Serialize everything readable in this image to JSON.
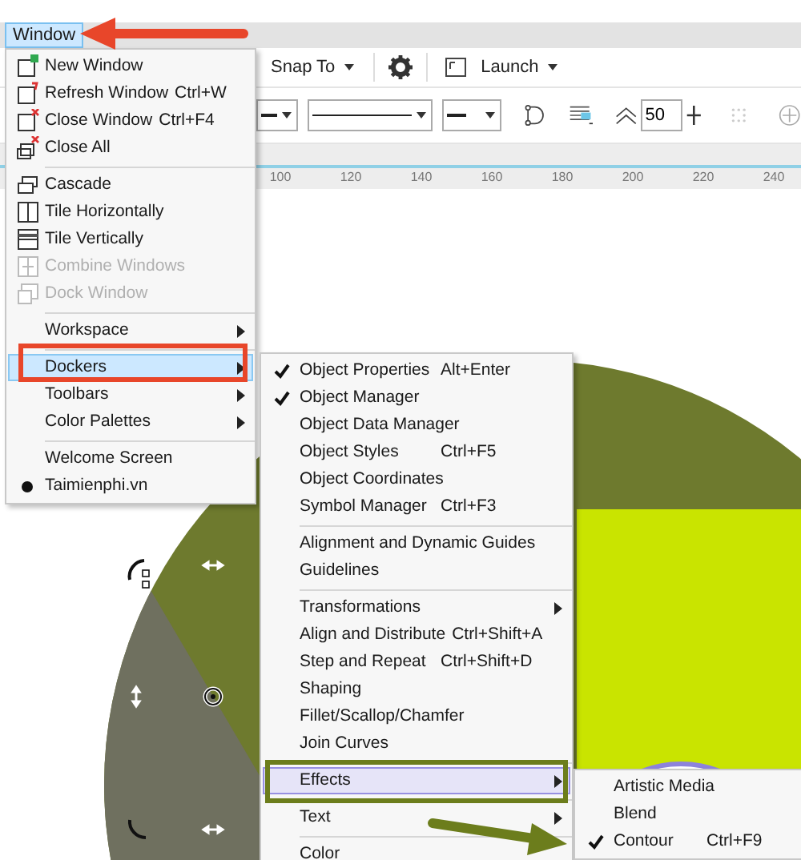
{
  "menu_bar": {
    "items": [
      {
        "label": "Window",
        "selected": true
      }
    ]
  },
  "toolbar": {
    "snap_button": {
      "label": "Snap To"
    },
    "launch_button": {
      "label": "Launch"
    }
  },
  "property_bar": {
    "smoothing_value": "50"
  },
  "ruler": {
    "labels": [
      "100",
      "120",
      "140",
      "160",
      "180",
      "200",
      "220",
      "240"
    ]
  },
  "window_menu": {
    "items": [
      {
        "kind": "item",
        "label": "New Window",
        "disabled": false,
        "selected": false,
        "checked": false,
        "submenu": false
      },
      {
        "kind": "item",
        "label": "Refresh Window",
        "shortcut": "Ctrl+W",
        "disabled": false,
        "selected": false,
        "checked": false,
        "submenu": false
      },
      {
        "kind": "item",
        "label": "Close Window",
        "shortcut": "Ctrl+F4",
        "disabled": false,
        "selected": false,
        "checked": false,
        "submenu": false
      },
      {
        "kind": "item",
        "label": "Close All",
        "disabled": false,
        "selected": false,
        "checked": false,
        "submenu": false
      },
      {
        "kind": "separator"
      },
      {
        "kind": "item",
        "label": "Cascade",
        "disabled": false,
        "selected": false,
        "checked": false,
        "submenu": false
      },
      {
        "kind": "item",
        "label": "Tile Horizontally",
        "disabled": false,
        "selected": false,
        "checked": false,
        "submenu": false
      },
      {
        "kind": "item",
        "label": "Tile Vertically",
        "disabled": false,
        "selected": false,
        "checked": false,
        "submenu": false
      },
      {
        "kind": "item",
        "label": "Combine Windows",
        "disabled": true,
        "selected": false,
        "checked": false,
        "submenu": false
      },
      {
        "kind": "item",
        "label": "Dock Window",
        "disabled": true,
        "selected": false,
        "checked": false,
        "submenu": false
      },
      {
        "kind": "separator"
      },
      {
        "kind": "item",
        "label": "Workspace",
        "disabled": false,
        "selected": false,
        "checked": false,
        "submenu": true
      },
      {
        "kind": "separator"
      },
      {
        "kind": "item",
        "label": "Dockers",
        "disabled": false,
        "selected": true,
        "checked": false,
        "submenu": true
      },
      {
        "kind": "item",
        "label": "Toolbars",
        "disabled": false,
        "selected": false,
        "checked": false,
        "submenu": true
      },
      {
        "kind": "item",
        "label": "Color Palettes",
        "disabled": false,
        "selected": false,
        "checked": false,
        "submenu": true
      },
      {
        "kind": "separator"
      },
      {
        "kind": "item",
        "label": "Welcome Screen",
        "disabled": false,
        "selected": false,
        "checked": false,
        "submenu": false
      },
      {
        "kind": "item",
        "label": "Taimienphi.vn",
        "disabled": false,
        "selected": false,
        "checked": true,
        "submenu": false
      }
    ]
  },
  "dockers_menu": {
    "items": [
      {
        "kind": "item",
        "label": "Object Properties",
        "shortcut": "Alt+Enter",
        "selected": false,
        "checked": true,
        "submenu": false
      },
      {
        "kind": "item",
        "label": "Object Manager",
        "selected": false,
        "checked": true,
        "submenu": false
      },
      {
        "kind": "item",
        "label": "Object Data Manager",
        "selected": false,
        "checked": false,
        "submenu": false
      },
      {
        "kind": "item",
        "label": "Object Styles",
        "shortcut": "Ctrl+F5",
        "selected": false,
        "checked": false,
        "submenu": false
      },
      {
        "kind": "item",
        "label": "Object Coordinates",
        "selected": false,
        "checked": false,
        "submenu": false
      },
      {
        "kind": "item",
        "label": "Symbol Manager",
        "shortcut": "Ctrl+F3",
        "selected": false,
        "checked": false,
        "submenu": false
      },
      {
        "kind": "separator"
      },
      {
        "kind": "item",
        "label": "Alignment and Dynamic Guides",
        "selected": false,
        "checked": false,
        "submenu": false
      },
      {
        "kind": "item",
        "label": "Guidelines",
        "selected": false,
        "checked": false,
        "submenu": false
      },
      {
        "kind": "separator"
      },
      {
        "kind": "item",
        "label": "Transformations",
        "selected": false,
        "checked": false,
        "submenu": true
      },
      {
        "kind": "item",
        "label": "Align and Distribute",
        "shortcut": "Ctrl+Shift+A",
        "selected": false,
        "checked": false,
        "submenu": false
      },
      {
        "kind": "item",
        "label": "Step and Repeat",
        "shortcut": "Ctrl+Shift+D",
        "selected": false,
        "checked": false,
        "submenu": false
      },
      {
        "kind": "item",
        "label": "Shaping",
        "selected": false,
        "checked": false,
        "submenu": false
      },
      {
        "kind": "item",
        "label": "Fillet/Scallop/Chamfer",
        "selected": false,
        "checked": false,
        "submenu": false
      },
      {
        "kind": "item",
        "label": "Join Curves",
        "selected": false,
        "checked": false,
        "submenu": false
      },
      {
        "kind": "separator"
      },
      {
        "kind": "item",
        "label": "Effects",
        "selected": true,
        "checked": false,
        "submenu": true
      },
      {
        "kind": "separator"
      },
      {
        "kind": "item",
        "label": "Text",
        "selected": false,
        "checked": false,
        "submenu": true
      },
      {
        "kind": "separator"
      },
      {
        "kind": "item",
        "label": "Color",
        "selected": false,
        "checked": false,
        "submenu": false
      }
    ]
  },
  "effects_menu": {
    "items": [
      {
        "kind": "item",
        "label": "Artistic Media",
        "selected": false,
        "checked": false,
        "submenu": false
      },
      {
        "kind": "item",
        "label": "Blend",
        "selected": false,
        "checked": false,
        "submenu": false
      },
      {
        "kind": "item",
        "label": "Contour",
        "shortcut": "Ctrl+F9",
        "selected": false,
        "checked": true,
        "submenu": false
      }
    ]
  }
}
